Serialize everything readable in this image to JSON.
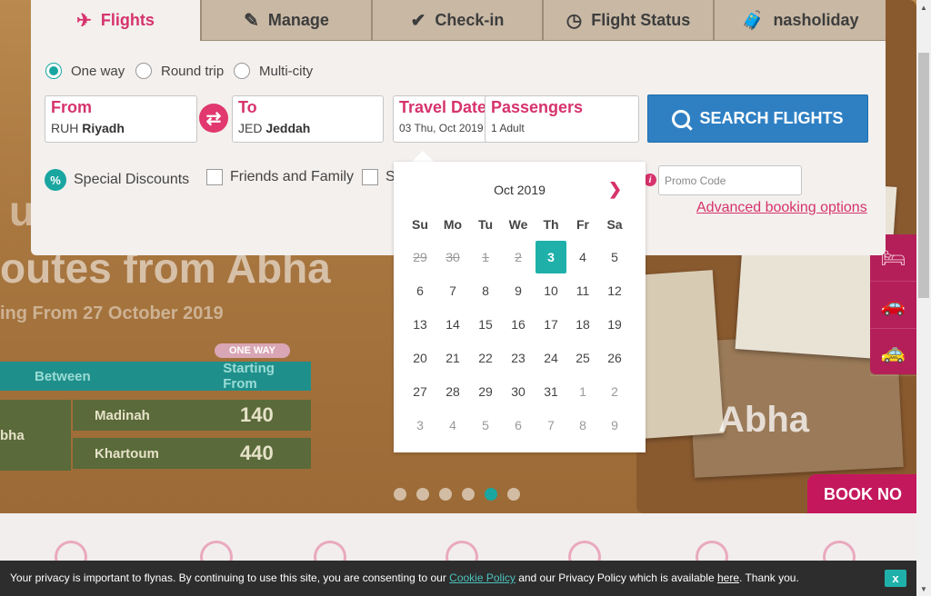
{
  "tabs": [
    {
      "label": "Flights",
      "icon": "plane-icon"
    },
    {
      "label": "Manage",
      "icon": "edit-icon"
    },
    {
      "label": "Check-in",
      "icon": "checkmark-icon"
    },
    {
      "label": "Flight Status",
      "icon": "clock-icon"
    },
    {
      "label": "nasholiday",
      "icon": "luggage-icon"
    }
  ],
  "trip_types": [
    {
      "label": "One way",
      "checked": true
    },
    {
      "label": "Round trip",
      "checked": false
    },
    {
      "label": "Multi-city",
      "checked": false
    }
  ],
  "from": {
    "label": "From",
    "code": "RUH",
    "city": "Riyadh"
  },
  "to": {
    "label": "To",
    "code": "JED",
    "city": "Jeddah"
  },
  "travel_dates": {
    "label": "Travel Dates",
    "value": "03 Thu, Oct 2019"
  },
  "passengers": {
    "label": "Passengers",
    "value": "1 Adult"
  },
  "search_label": "SEARCH FLIGHTS",
  "options": {
    "special_discounts": "Special Discounts",
    "friends_family": "Friends and Family",
    "third": "S"
  },
  "promo": {
    "placeholder": "Promo Code"
  },
  "advanced_label": "Advanced booking options",
  "calendar": {
    "month": "Oct 2019",
    "dow": [
      "Su",
      "Mo",
      "Tu",
      "We",
      "Th",
      "Fr",
      "Sa"
    ],
    "weeks": [
      [
        {
          "d": "29",
          "s": "past"
        },
        {
          "d": "30",
          "s": "past"
        },
        {
          "d": "1",
          "s": "past"
        },
        {
          "d": "2",
          "s": "past"
        },
        {
          "d": "3",
          "s": "selected"
        },
        {
          "d": "4",
          "s": ""
        },
        {
          "d": "5",
          "s": ""
        }
      ],
      [
        {
          "d": "6",
          "s": ""
        },
        {
          "d": "7",
          "s": ""
        },
        {
          "d": "8",
          "s": ""
        },
        {
          "d": "9",
          "s": ""
        },
        {
          "d": "10",
          "s": ""
        },
        {
          "d": "11",
          "s": ""
        },
        {
          "d": "12",
          "s": ""
        }
      ],
      [
        {
          "d": "13",
          "s": ""
        },
        {
          "d": "14",
          "s": ""
        },
        {
          "d": "15",
          "s": ""
        },
        {
          "d": "16",
          "s": ""
        },
        {
          "d": "17",
          "s": ""
        },
        {
          "d": "18",
          "s": ""
        },
        {
          "d": "19",
          "s": ""
        }
      ],
      [
        {
          "d": "20",
          "s": ""
        },
        {
          "d": "21",
          "s": ""
        },
        {
          "d": "22",
          "s": ""
        },
        {
          "d": "23",
          "s": ""
        },
        {
          "d": "24",
          "s": ""
        },
        {
          "d": "25",
          "s": ""
        },
        {
          "d": "26",
          "s": ""
        }
      ],
      [
        {
          "d": "27",
          "s": ""
        },
        {
          "d": "28",
          "s": ""
        },
        {
          "d": "29",
          "s": ""
        },
        {
          "d": "30",
          "s": ""
        },
        {
          "d": "31",
          "s": ""
        },
        {
          "d": "1",
          "s": "other"
        },
        {
          "d": "2",
          "s": "other"
        }
      ],
      [
        {
          "d": "3",
          "s": "other"
        },
        {
          "d": "4",
          "s": "other"
        },
        {
          "d": "5",
          "s": "other"
        },
        {
          "d": "6",
          "s": "other"
        },
        {
          "d": "7",
          "s": "other"
        },
        {
          "d": "8",
          "s": "other"
        },
        {
          "d": "9",
          "s": "other"
        }
      ]
    ]
  },
  "hero": {
    "line1": "ur new",
    "line2": "outes from Abha",
    "line3": "ing From 27 October 2019",
    "tag": "ONE WAY",
    "table_head": [
      "Between",
      "Starting From"
    ],
    "origin": "bha",
    "rows": [
      {
        "dest": "Madinah",
        "price": "140"
      },
      {
        "dest": "Khartoum",
        "price": "440"
      }
    ],
    "photo_text": "Abha",
    "book_now": "BOOK NO",
    "slide_count": 6,
    "active_slide": 4
  },
  "cookie": {
    "text1": "Your privacy is important to flynas. By continuing to use this site, you are consenting to our ",
    "link1": "Cookie Policy",
    "text2": " and our Privacy Policy which is available ",
    "link2": "here",
    "text3": ". Thank you.",
    "close": "x"
  },
  "colors": {
    "accent": "#d6336c",
    "teal": "#1aa6a0",
    "search": "#2f80c3"
  }
}
